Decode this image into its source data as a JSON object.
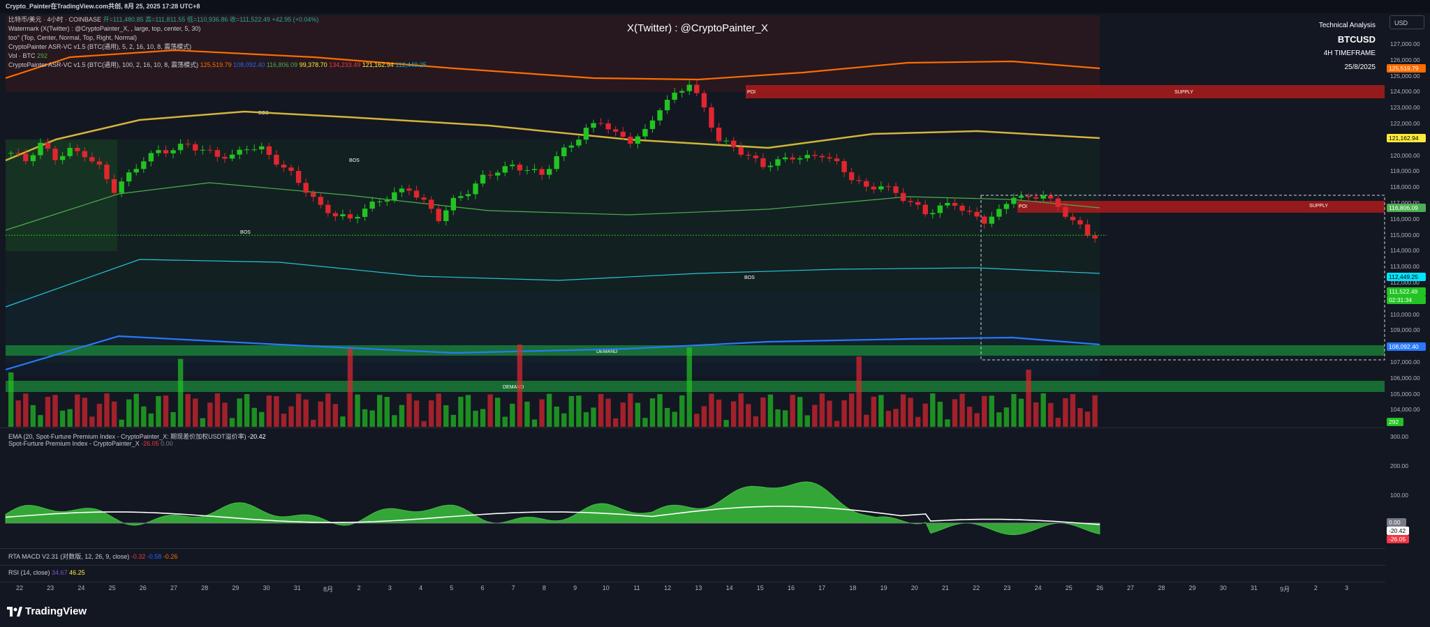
{
  "header": {
    "title": "Crypto_Painter在TradingView.com共创, 8月 25, 2025 17:28 UTC+8"
  },
  "legend": {
    "main": "比特币/美元 · 4小时 · COINBASE",
    "ohlc": "开=111,480.85  高=111,811.55  低=110,936.86  收=111,522.49  +42.95 (+0.04%)",
    "watermark": "Watermark (X(Twitter) : @CryptoPainter_X, , large, top, center, 5, 30)",
    "too": "too° (Top, Center, Normal, Top, Right, Normal)",
    "asr1": "CryptoPainter ASR-VC v1.5 (BTC(通用), 5, 2, 16, 10, 8, 震荡模式)",
    "vol_label": "Vol · BTC",
    "vol_value": "292",
    "asr2": "CryptoPainter ASR-VC v1.5 (BTC(通用), 100, 2, 16, 10, 8, 震荡模式)",
    "asr2_values": [
      "125,519.79",
      "108,092.40",
      "116,806.09",
      "99,378.70",
      "134,233.49",
      "121,162.94",
      "112,449.25"
    ]
  },
  "watermark_text": "X(Twitter) : @CryptoPainter_X",
  "analysis": {
    "title": "Technical Analysis",
    "symbol": "BTCUSD",
    "timeframe": "4H TIMEFRAME",
    "date": "25/8/2025"
  },
  "currency": "USD",
  "price_axis": [
    "127,000.00",
    "126,000.00",
    "125,000.00",
    "124,000.00",
    "123,000.00",
    "122,000.00",
    "121,000.00",
    "120,000.00",
    "119,000.00",
    "118,000.00",
    "117,000.00",
    "116,000.00",
    "115,000.00",
    "114,000.00",
    "113,000.00",
    "112,000.00",
    "111,000.00",
    "110,000.00",
    "109,000.00",
    "108,000.00",
    "107,000.00",
    "106,000.00",
    "105,000.00",
    "104,000.00"
  ],
  "price_tags": {
    "orange": "125,519.79",
    "yellow": "121,162.94",
    "green": "116,806.09",
    "cyan": "112,449.25",
    "last": "111,522.49",
    "countdown": "02:31:34",
    "blue": "108,092.40",
    "volume": "292"
  },
  "zones": {
    "poi": "POI",
    "supply": "SUPPLY",
    "demand": "DEMAND",
    "bos": "BOS"
  },
  "time_axis": [
    "22",
    "23",
    "24",
    "25",
    "26",
    "27",
    "28",
    "29",
    "30",
    "31",
    "8月",
    "2",
    "3",
    "4",
    "5",
    "6",
    "7",
    "8",
    "9",
    "10",
    "11",
    "12",
    "13",
    "14",
    "15",
    "16",
    "17",
    "18",
    "19",
    "20",
    "21",
    "22",
    "23",
    "24",
    "25",
    "26",
    "27",
    "28",
    "29",
    "30",
    "31",
    "9月",
    "2",
    "3"
  ],
  "premium_pane": {
    "title1": "EMA (20, Spot-Furture Premium Index - CryptoPainter_X: 期现差价加权USDT溢价率)",
    "title1_value": "-20.42",
    "title2": "Spot-Furture Premium Index - CryptoPainter_X",
    "title2_values": [
      "-26.05",
      "0.00"
    ],
    "axis": [
      "300.00",
      "200.00",
      "100.00"
    ],
    "tag_zero": "0.00",
    "tag_ema": "-20.42",
    "tag_idx": "-26.05"
  },
  "macd_pane": {
    "title": "RTA MACD V2.31 (对数版, 12, 26, 9, close)",
    "values": [
      "-0.32",
      "-0.58",
      "-0.26"
    ]
  },
  "rsi_pane": {
    "title": "RSI (14, close)",
    "values": [
      "34.67",
      "46.25"
    ]
  },
  "logo": "TradingView",
  "colors": {
    "bull": "#22c322",
    "bear": "#e0262f",
    "orange": "#ff6d00",
    "yellow": "#d4b53a",
    "blue": "#2979ff",
    "cyan": "#00bcd4",
    "supply": "#b71c1c",
    "demand": "#1b8a3a"
  },
  "chart_data": {
    "type": "line",
    "title": "BTCUSD",
    "price_range": [
      103500,
      127800
    ],
    "close_series_approx": [
      118200,
      117600,
      118900,
      117800,
      118400,
      118100,
      117000,
      115200,
      116400,
      117700,
      118300,
      118500,
      118900,
      118400,
      118000,
      117900,
      118700,
      118500,
      117500,
      116500,
      115200,
      113800,
      113200,
      112800,
      113700,
      114300,
      114900,
      115300,
      114200,
      112900,
      114300,
      115100,
      116200,
      116800,
      117100,
      116900,
      116400,
      117900,
      118900,
      120100,
      120800,
      119700,
      119200,
      119900,
      121900,
      122900,
      123900,
      121800,
      119200,
      118700,
      117900,
      117200,
      117500,
      117900,
      117800,
      118100,
      117300,
      116200,
      115300,
      115600,
      114900,
      114200,
      113300,
      113800,
      114100,
      113200,
      112700,
      113400,
      114800,
      114400,
      114900,
      113700,
      112800,
      111500
    ]
  }
}
